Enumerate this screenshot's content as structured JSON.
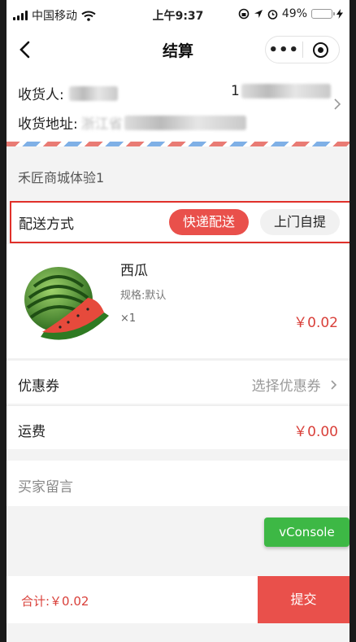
{
  "status_bar": {
    "carrier": "中国移动",
    "time": "上午9:37",
    "battery_percent": "49%",
    "battery_level": 0.49
  },
  "nav": {
    "title": "结算",
    "back_icon": "chevron-left-icon",
    "more_icon": "more-dots-icon",
    "close_icon": "target-close-icon"
  },
  "address": {
    "receiver_label": "收货人:",
    "phone_prefix": "1",
    "address_label": "收货地址:",
    "address_prefix": "浙江省"
  },
  "shop": {
    "name": "禾匠商城体验1"
  },
  "delivery": {
    "label": "配送方式",
    "options": [
      {
        "label": "快递配送",
        "selected": true
      },
      {
        "label": "上门自提",
        "selected": false
      }
    ],
    "selected_color": "#e9504b"
  },
  "product": {
    "name": "西瓜",
    "spec": "规格:默认",
    "quantity": "×1",
    "price": "￥0.02"
  },
  "coupon": {
    "label": "优惠券",
    "action": "选择优惠券"
  },
  "freight": {
    "label": "运费",
    "value": "￥0.00"
  },
  "message": {
    "placeholder": "买家留言"
  },
  "vconsole": {
    "label": "vConsole"
  },
  "footer": {
    "total": "合计:￥0.02",
    "submit_label": "提交"
  },
  "colors": {
    "accent": "#e9504b",
    "price_red": "#d9403a",
    "vconsole_green": "#3db845",
    "highlight_border": "#e0302a"
  }
}
